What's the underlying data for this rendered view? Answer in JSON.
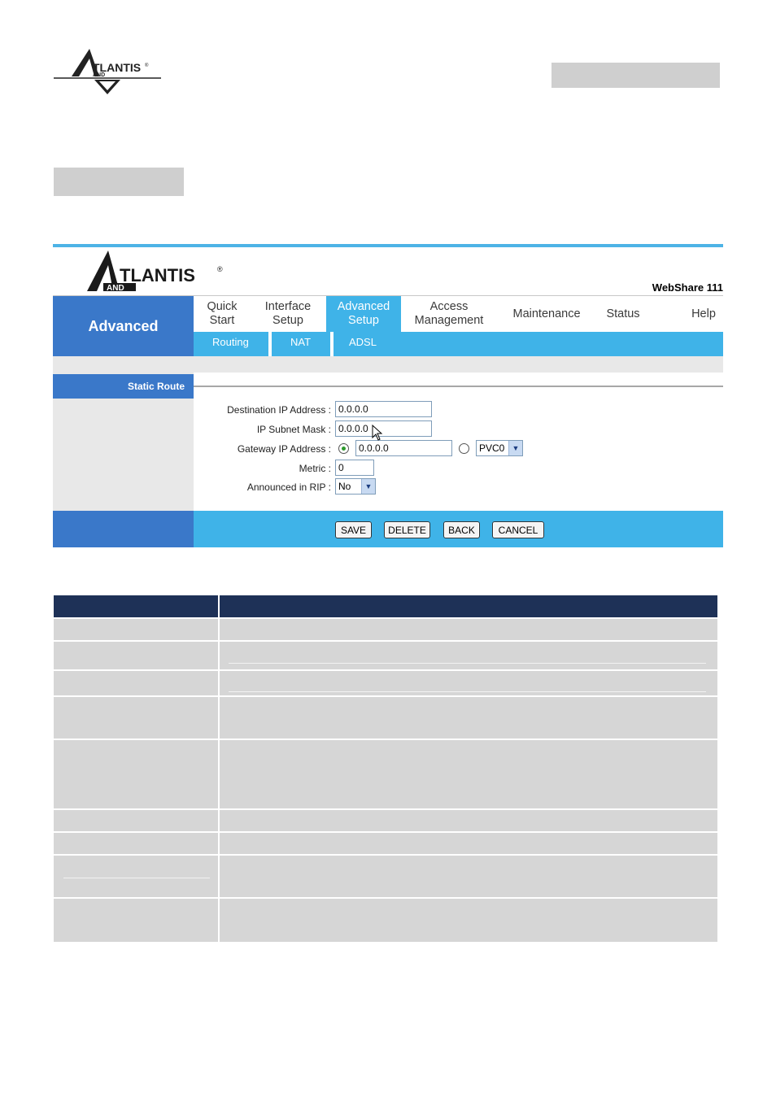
{
  "page": {
    "logo_text": "ATLANTIS LAND"
  },
  "screenshot": {
    "brand_logo": "ATLANTIS LAND",
    "product_name": "WebShare 111",
    "side_label": "Advanced",
    "nav": {
      "items": [
        {
          "label": "Quick\nStart",
          "line1": "Quick",
          "line2": "Start"
        },
        {
          "line1": "Interface",
          "line2": "Setup"
        },
        {
          "line1": "Advanced",
          "line2": "Setup",
          "active": true
        },
        {
          "line1": "Access",
          "line2": "Management"
        },
        {
          "line1": "Maintenance"
        },
        {
          "line1": "Status"
        },
        {
          "line1": "Help"
        }
      ]
    },
    "subnav": [
      "Routing",
      "NAT",
      "ADSL"
    ],
    "section_title": "Static Route",
    "form": {
      "dest_label": "Destination IP Address :",
      "dest_value": "0.0.0.0",
      "mask_label": "IP Subnet Mask :",
      "mask_value": "0.0.0.0",
      "gateway_label": "Gateway IP Address :",
      "gateway_value": "0.0.0.0",
      "gateway_mode": "ip",
      "pvc_value": "PVC0",
      "metric_label": "Metric :",
      "metric_value": "0",
      "rip_label": "Announced in RIP :",
      "rip_value": "No"
    },
    "buttons": {
      "save": "SAVE",
      "delete": "DELETE",
      "back": "BACK",
      "cancel": "CANCEL"
    }
  },
  "colors": {
    "accent_blue": "#3a78c9",
    "light_blue": "#3fb3e8",
    "table_header": "#1e3157",
    "table_row": "#d6d6d6"
  }
}
